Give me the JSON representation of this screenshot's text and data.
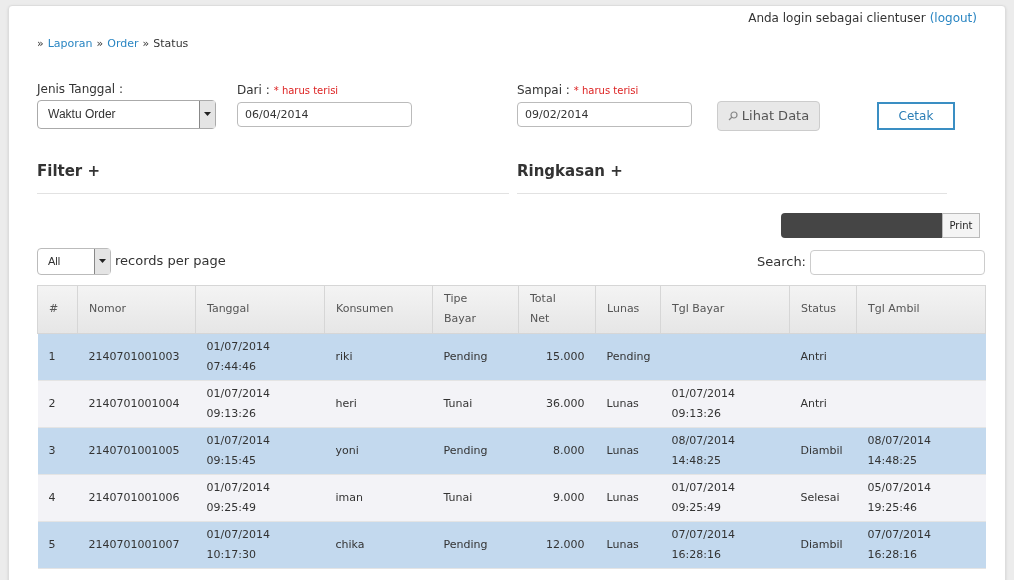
{
  "user_bar": {
    "text": "Anda login sebagai clientuser",
    "logout": "(logout)"
  },
  "breadcrumb": [
    {
      "label": "Laporan",
      "link": true
    },
    {
      "label": "Order",
      "link": true
    },
    {
      "label": "Status",
      "link": false
    }
  ],
  "breadcrumb_separator": "»",
  "form": {
    "jenis_label": "Jenis Tanggal :",
    "jenis_value": "Waktu Order",
    "dari_label": "Dari :",
    "sampai_label": "Sampai :",
    "dari_required_note": "* harus terisi",
    "sampai_required_note": "* harus terisi",
    "dari_value": "06/04/2014",
    "sampai_value": "09/02/2014",
    "view_button": "Lihat Data",
    "print_button": "Cetak"
  },
  "sections": [
    {
      "title": "Filter +"
    },
    {
      "title": "Ringkasan +"
    }
  ],
  "print_button": "Print",
  "length": {
    "value": "All",
    "label": "records per page"
  },
  "search_label": "Search:",
  "table": {
    "columns": [
      "#",
      "Nomor",
      "Tanggal",
      "Konsumen",
      "Tipe Bayar",
      "Total Net",
      "Lunas",
      "Tgl Bayar",
      "Status",
      "Tgl Ambil"
    ],
    "rows": [
      [
        "1",
        "2140701001003",
        "01/07/2014 07:44:46",
        "riki",
        "Pending",
        "15.000",
        "Pending",
        "",
        "Antri",
        ""
      ],
      [
        "2",
        "2140701001004",
        "01/07/2014 09:13:26",
        "heri",
        "Tunai",
        "36.000",
        "Lunas",
        "01/07/2014 09:13:26",
        "Antri",
        ""
      ],
      [
        "3",
        "2140701001005",
        "01/07/2014 09:15:45",
        "yoni",
        "Pending",
        "8.000",
        "Lunas",
        "08/07/2014 14:48:25",
        "Diambil",
        "08/07/2014 14:48:25"
      ],
      [
        "4",
        "2140701001006",
        "01/07/2014 09:25:49",
        "iman",
        "Tunai",
        "9.000",
        "Lunas",
        "01/07/2014 09:25:49",
        "Selesai",
        "05/07/2014 19:25:46"
      ],
      [
        "5",
        "2140701001007",
        "01/07/2014 10:17:30",
        "chika",
        "Pending",
        "12.000",
        "Lunas",
        "07/07/2014 16:28:16",
        "Diambil",
        "07/07/2014 16:28:16"
      ]
    ]
  }
}
